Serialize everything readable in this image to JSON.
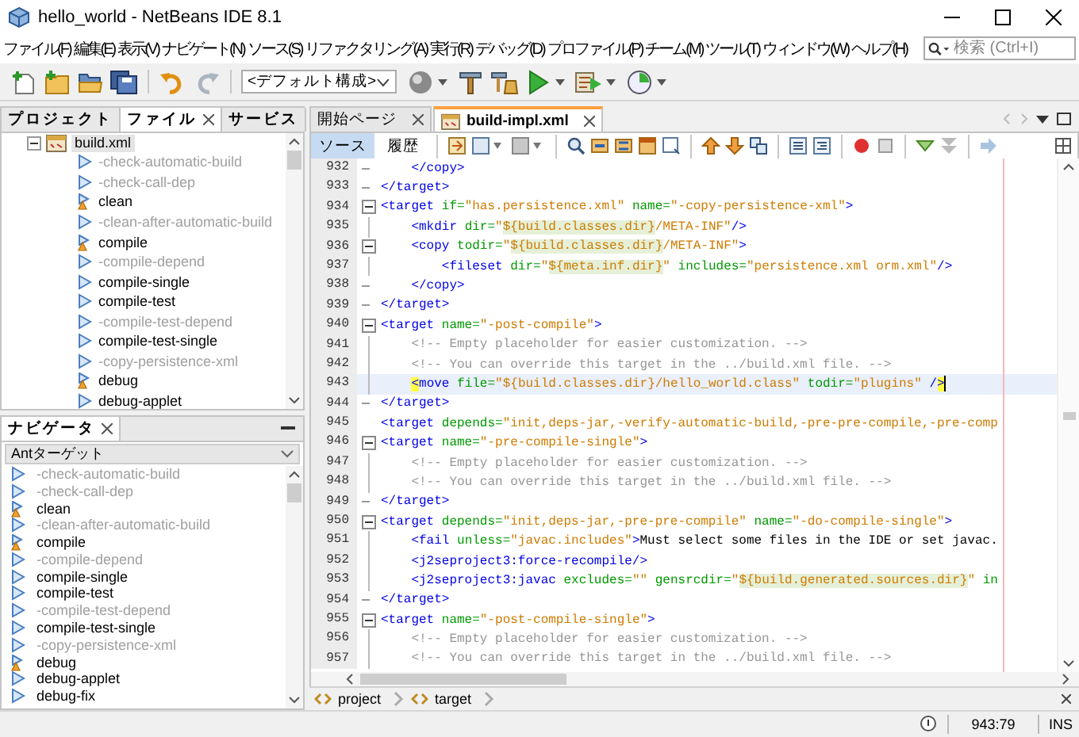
{
  "window": {
    "title": "hello_world - NetBeans IDE 8.1"
  },
  "menu": [
    "ファイル(F)",
    "編集(E)",
    "表示(V)",
    "ナビゲート(N)",
    "ソース(S)",
    "リファクタリング(A)",
    "実行(R)",
    "デバッグ(D)",
    "プロファイル(P)",
    "チーム(M)",
    "ツール(T)",
    "ウィンドウ(W)",
    "ヘルプ(H)"
  ],
  "search": {
    "placeholder": "検索 (Ctrl+I)"
  },
  "toolbar": {
    "config": "<デフォルト構成>"
  },
  "left_tabs": [
    {
      "label": "プロジェクト",
      "selected": false
    },
    {
      "label": "ファイル",
      "selected": true
    },
    {
      "label": "サービス",
      "selected": false
    }
  ],
  "file_tree": [
    {
      "label": "build.xml",
      "expanded": true,
      "children": [
        {
          "label": "-check-automatic-build",
          "private": true,
          "kind": "plain"
        },
        {
          "label": "-check-call-dep",
          "private": true,
          "kind": "plain"
        },
        {
          "label": "clean",
          "private": false,
          "kind": "warned"
        },
        {
          "label": "-clean-after-automatic-build",
          "private": true,
          "kind": "plain"
        },
        {
          "label": "compile",
          "private": false,
          "kind": "warned"
        },
        {
          "label": "-compile-depend",
          "private": true,
          "kind": "plain"
        },
        {
          "label": "compile-single",
          "private": false,
          "kind": "plain"
        },
        {
          "label": "compile-test",
          "private": false,
          "kind": "plain"
        },
        {
          "label": "-compile-test-depend",
          "private": true,
          "kind": "plain"
        },
        {
          "label": "compile-test-single",
          "private": false,
          "kind": "plain"
        },
        {
          "label": "-copy-persistence-xml",
          "private": true,
          "kind": "plain"
        },
        {
          "label": "debug",
          "private": false,
          "kind": "warned"
        },
        {
          "label": "debug-applet",
          "private": false,
          "kind": "plain"
        }
      ]
    }
  ],
  "navigator": {
    "tab": "ナビゲータ",
    "filter": "Antターゲット",
    "items": [
      {
        "label": "-check-automatic-build",
        "private": true,
        "kind": "plain"
      },
      {
        "label": "-check-call-dep",
        "private": true,
        "kind": "plain"
      },
      {
        "label": "clean",
        "private": false,
        "kind": "warned"
      },
      {
        "label": "-clean-after-automatic-build",
        "private": true,
        "kind": "plain"
      },
      {
        "label": "compile",
        "private": false,
        "kind": "warned"
      },
      {
        "label": "-compile-depend",
        "private": true,
        "kind": "plain"
      },
      {
        "label": "compile-single",
        "private": false,
        "kind": "plain"
      },
      {
        "label": "compile-test",
        "private": false,
        "kind": "plain"
      },
      {
        "label": "-compile-test-depend",
        "private": true,
        "kind": "plain"
      },
      {
        "label": "compile-test-single",
        "private": false,
        "kind": "plain"
      },
      {
        "label": "-copy-persistence-xml",
        "private": true,
        "kind": "plain"
      },
      {
        "label": "debug",
        "private": false,
        "kind": "warned"
      },
      {
        "label": "debug-applet",
        "private": false,
        "kind": "plain"
      },
      {
        "label": "debug-fix",
        "private": false,
        "kind": "plain"
      }
    ]
  },
  "editor_tabs": [
    {
      "label": "開始ページ",
      "selected": false,
      "kind": "page"
    },
    {
      "label": "build-impl.xml",
      "selected": true,
      "kind": "xml"
    }
  ],
  "view_tabs": [
    {
      "label": "ソース",
      "selected": true
    },
    {
      "label": "履歴",
      "selected": false
    }
  ],
  "code": [
    {
      "number": "932",
      "kind": "fold_end",
      "current": false,
      "segments": [
        {
          "kind": "tag",
          "text": "    </copy>"
        }
      ]
    },
    {
      "number": "933",
      "kind": "fold_end",
      "current": false,
      "segments": [
        {
          "kind": "tag",
          "text": "</target>"
        }
      ]
    },
    {
      "number": "934",
      "kind": "fold_start",
      "current": false,
      "segments": [
        {
          "kind": "tag",
          "text": "<target "
        },
        {
          "kind": "attr",
          "text": "if="
        },
        {
          "kind": "value",
          "text": "\"has.persistence.xml\""
        },
        {
          "kind": "attr",
          "text": " name="
        },
        {
          "kind": "value",
          "text": "\"-copy-persistence-xml\""
        },
        {
          "kind": "tag",
          "text": ">"
        }
      ]
    },
    {
      "number": "935",
      "kind": "fold_body",
      "current": false,
      "segments": [
        {
          "kind": "tag",
          "text": "    <mkdir "
        },
        {
          "kind": "attr",
          "text": "dir="
        },
        {
          "kind": "value",
          "text": "\""
        },
        {
          "kind": "var",
          "text": "${build.classes.dir}"
        },
        {
          "kind": "value",
          "text": "/META-INF\""
        },
        {
          "kind": "tag",
          "text": "/>"
        }
      ]
    },
    {
      "number": "936",
      "kind": "fold_start",
      "current": false,
      "segments": [
        {
          "kind": "tag",
          "text": "    <copy "
        },
        {
          "kind": "attr",
          "text": "todir="
        },
        {
          "kind": "value",
          "text": "\""
        },
        {
          "kind": "var",
          "text": "${build.classes.dir}"
        },
        {
          "kind": "value",
          "text": "/META-INF\""
        },
        {
          "kind": "tag",
          "text": ">"
        }
      ]
    },
    {
      "number": "937",
      "kind": "fold_body",
      "current": false,
      "segments": [
        {
          "kind": "tag",
          "text": "        <fileset "
        },
        {
          "kind": "attr",
          "text": "dir="
        },
        {
          "kind": "value",
          "text": "\""
        },
        {
          "kind": "var",
          "text": "${meta.inf.dir}"
        },
        {
          "kind": "value",
          "text": "\""
        },
        {
          "kind": "attr",
          "text": " includes="
        },
        {
          "kind": "value",
          "text": "\"persistence.xml orm.xml\""
        },
        {
          "kind": "tag",
          "text": "/>"
        }
      ]
    },
    {
      "number": "938",
      "kind": "fold_end",
      "current": false,
      "segments": [
        {
          "kind": "tag",
          "text": "    </copy>"
        }
      ]
    },
    {
      "number": "939",
      "kind": "fold_end",
      "current": false,
      "segments": [
        {
          "kind": "tag",
          "text": "</target>"
        }
      ]
    },
    {
      "number": "940",
      "kind": "fold_start",
      "current": false,
      "segments": [
        {
          "kind": "tag",
          "text": "<target "
        },
        {
          "kind": "attr",
          "text": "name="
        },
        {
          "kind": "value",
          "text": "\"-post-compile\""
        },
        {
          "kind": "tag",
          "text": ">"
        }
      ]
    },
    {
      "number": "941",
      "kind": "fold_body",
      "current": false,
      "segments": [
        {
          "kind": "comment",
          "text": "    <!-- Empty placeholder for easier customization. -->"
        }
      ]
    },
    {
      "number": "942",
      "kind": "fold_body",
      "current": false,
      "segments": [
        {
          "kind": "comment",
          "text": "    <!-- You can override this target in the ../build.xml file. -->"
        }
      ]
    },
    {
      "number": "943",
      "kind": "fold_body",
      "current": true,
      "segments": [
        {
          "kind": "match",
          "text": "    <"
        },
        {
          "kind": "tag",
          "text": "move "
        },
        {
          "kind": "attr",
          "text": "file="
        },
        {
          "kind": "value",
          "text": "\"${build.classes.dir}/hello_world.class\""
        },
        {
          "kind": "attr",
          "text": " todir="
        },
        {
          "kind": "value",
          "text": "\"plugins\""
        },
        {
          "kind": "tag",
          "text": " /"
        },
        {
          "kind": "match",
          "text": ">"
        }
      ]
    },
    {
      "number": "944",
      "kind": "fold_end",
      "current": false,
      "segments": [
        {
          "kind": "tag",
          "text": "</target>"
        }
      ]
    },
    {
      "number": "945",
      "kind": "plain",
      "current": false,
      "segments": [
        {
          "kind": "tag",
          "text": "<target "
        },
        {
          "kind": "attr",
          "text": "depends="
        },
        {
          "kind": "value",
          "text": "\"init,deps-jar,-verify-automatic-build,-pre-pre-compile,-pre-comp"
        }
      ]
    },
    {
      "number": "946",
      "kind": "fold_start",
      "current": false,
      "segments": [
        {
          "kind": "tag",
          "text": "<target "
        },
        {
          "kind": "attr",
          "text": "name="
        },
        {
          "kind": "value",
          "text": "\"-pre-compile-single\""
        },
        {
          "kind": "tag",
          "text": ">"
        }
      ]
    },
    {
      "number": "947",
      "kind": "fold_body",
      "current": false,
      "segments": [
        {
          "kind": "comment",
          "text": "    <!-- Empty placeholder for easier customization. -->"
        }
      ]
    },
    {
      "number": "948",
      "kind": "fold_body",
      "current": false,
      "segments": [
        {
          "kind": "comment",
          "text": "    <!-- You can override this target in the ../build.xml file. -->"
        }
      ]
    },
    {
      "number": "949",
      "kind": "fold_end",
      "current": false,
      "segments": [
        {
          "kind": "tag",
          "text": "</target>"
        }
      ]
    },
    {
      "number": "950",
      "kind": "fold_start",
      "current": false,
      "segments": [
        {
          "kind": "tag",
          "text": "<target "
        },
        {
          "kind": "attr",
          "text": "depends="
        },
        {
          "kind": "value",
          "text": "\"init,deps-jar,-pre-pre-compile\""
        },
        {
          "kind": "attr",
          "text": " name="
        },
        {
          "kind": "value",
          "text": "\"-do-compile-single\""
        },
        {
          "kind": "tag",
          "text": ">"
        }
      ]
    },
    {
      "number": "951",
      "kind": "fold_body",
      "current": false,
      "segments": [
        {
          "kind": "tag",
          "text": "    <fail "
        },
        {
          "kind": "attr",
          "text": "unless="
        },
        {
          "kind": "value",
          "text": "\"javac.includes\""
        },
        {
          "kind": "tag",
          "text": ">"
        },
        {
          "kind": "text",
          "text": "Must select some files in the IDE or set javac."
        }
      ]
    },
    {
      "number": "952",
      "kind": "fold_body",
      "current": false,
      "segments": [
        {
          "kind": "tag",
          "text": "    <j2seproject3:force-recompile/>"
        }
      ]
    },
    {
      "number": "953",
      "kind": "fold_body",
      "current": false,
      "segments": [
        {
          "kind": "tag",
          "text": "    <j2seproject3:javac "
        },
        {
          "kind": "attr",
          "text": "excludes="
        },
        {
          "kind": "value",
          "text": "\"\""
        },
        {
          "kind": "attr",
          "text": " gensrcdir="
        },
        {
          "kind": "value",
          "text": "\""
        },
        {
          "kind": "var",
          "text": "${build.generated.sources.dir}"
        },
        {
          "kind": "value",
          "text": "\""
        },
        {
          "kind": "attr",
          "text": " in"
        }
      ]
    },
    {
      "number": "954",
      "kind": "fold_end",
      "current": false,
      "segments": [
        {
          "kind": "tag",
          "text": "</target>"
        }
      ]
    },
    {
      "number": "955",
      "kind": "fold_start",
      "current": false,
      "segments": [
        {
          "kind": "tag",
          "text": "<target "
        },
        {
          "kind": "attr",
          "text": "name="
        },
        {
          "kind": "value",
          "text": "\"-post-compile-single\""
        },
        {
          "kind": "tag",
          "text": ">"
        }
      ]
    },
    {
      "number": "956",
      "kind": "fold_body",
      "current": false,
      "segments": [
        {
          "kind": "comment",
          "text": "    <!-- Empty placeholder for easier customization. -->"
        }
      ]
    },
    {
      "number": "957",
      "kind": "fold_body",
      "current": false,
      "segments": [
        {
          "kind": "comment",
          "text": "    <!-- You can override this target in the ../build.xml file. -->"
        }
      ]
    }
  ],
  "breadcrumbs": [
    "project",
    "target"
  ],
  "status_bar": {
    "position": "943:79",
    "mode": "INS"
  }
}
